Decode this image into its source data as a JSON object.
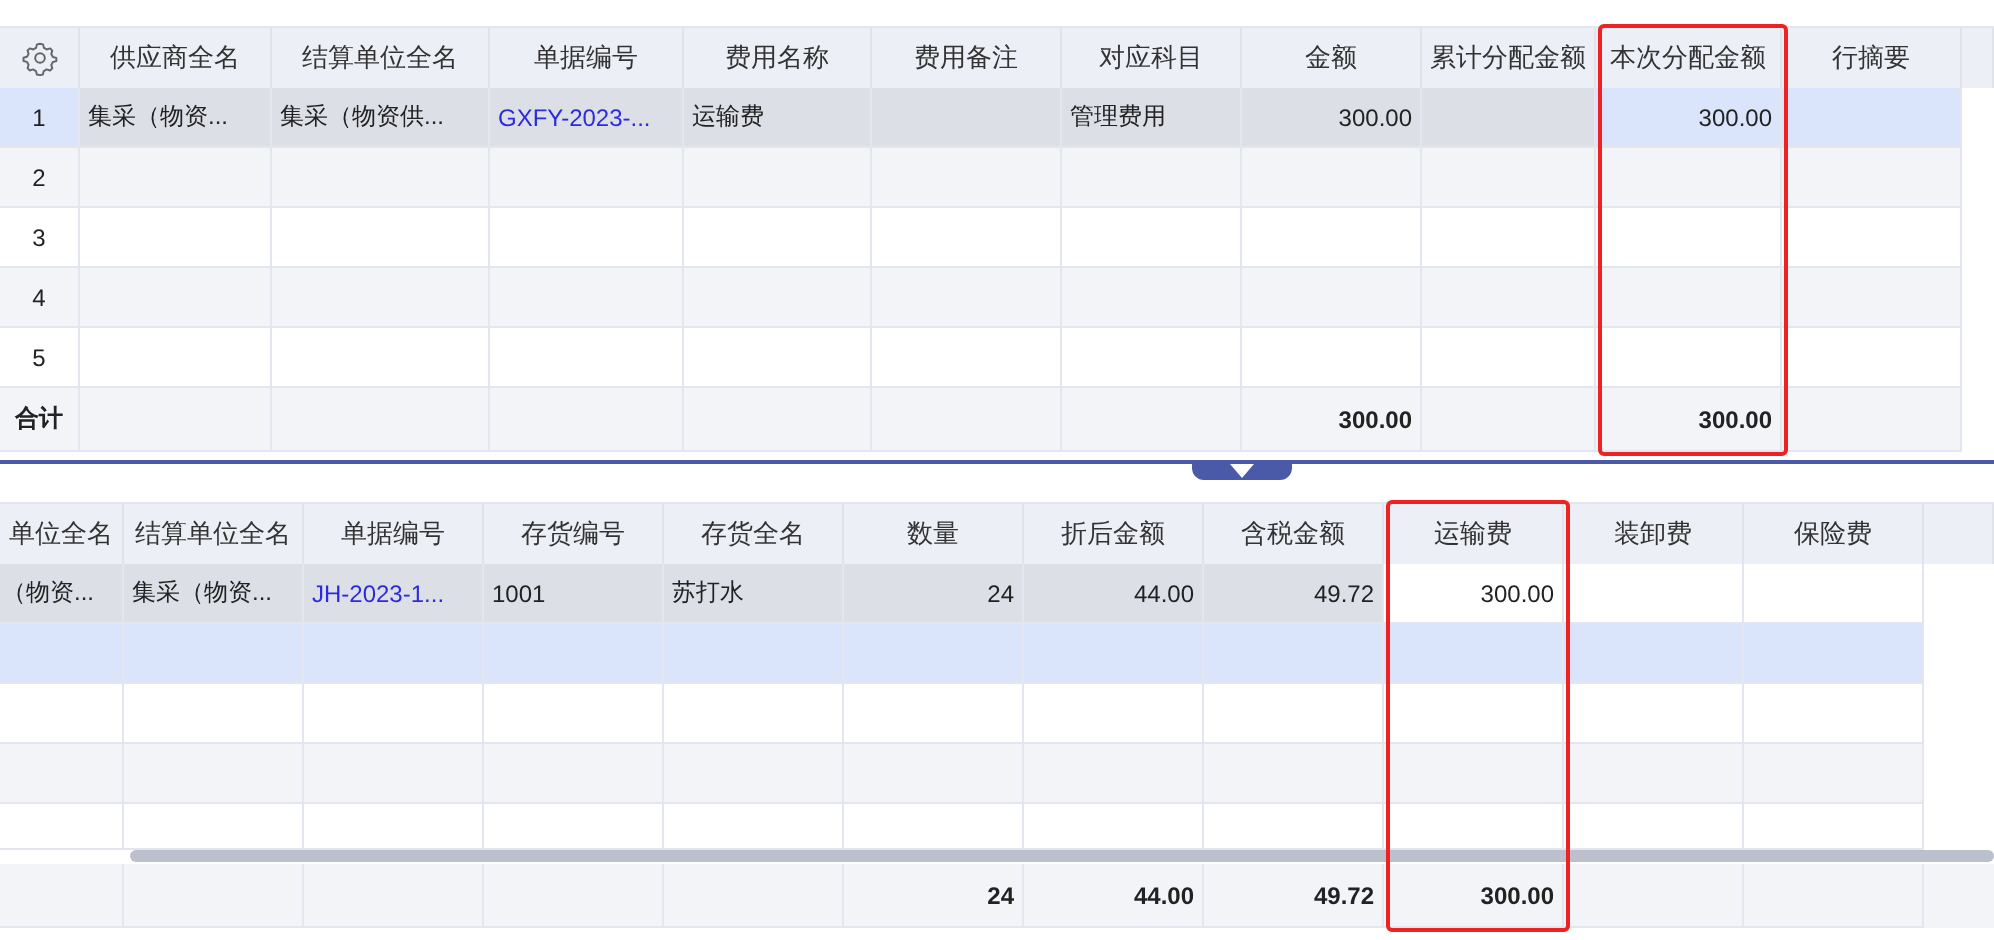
{
  "top_table": {
    "columns": [
      {
        "label": "供应商全名",
        "kind": "text",
        "editable": false,
        "highlighted": false
      },
      {
        "label": "结算单位全名",
        "kind": "text",
        "editable": false,
        "highlighted": false
      },
      {
        "label": "单据编号",
        "kind": "link",
        "editable": false,
        "highlighted": false
      },
      {
        "label": "费用名称",
        "kind": "text",
        "editable": false,
        "highlighted": false
      },
      {
        "label": "费用备注",
        "kind": "text",
        "editable": false,
        "highlighted": false
      },
      {
        "label": "对应科目",
        "kind": "text",
        "editable": false,
        "highlighted": false
      },
      {
        "label": "金额",
        "kind": "amount",
        "editable": false,
        "highlighted": false
      },
      {
        "label": "累计分配金额",
        "kind": "amount",
        "editable": false,
        "highlighted": false
      },
      {
        "label": "本次分配金额",
        "kind": "amount",
        "editable": true,
        "highlighted": true
      },
      {
        "label": "行摘要",
        "kind": "text",
        "editable": true,
        "highlighted": false
      }
    ],
    "rows": [
      {
        "number": "1",
        "selected": true,
        "cells": [
          "集采（物资...",
          "集采（物资供...",
          "GXFY-2023-...",
          "运输费",
          "",
          "管理费用",
          "300.00",
          "",
          "300.00",
          ""
        ]
      },
      {
        "number": "2",
        "selected": false,
        "cells": [
          "",
          "",
          "",
          "",
          "",
          "",
          "",
          "",
          "",
          ""
        ]
      },
      {
        "number": "3",
        "selected": false,
        "cells": [
          "",
          "",
          "",
          "",
          "",
          "",
          "",
          "",
          "",
          ""
        ]
      },
      {
        "number": "4",
        "selected": false,
        "cells": [
          "",
          "",
          "",
          "",
          "",
          "",
          "",
          "",
          "",
          ""
        ]
      },
      {
        "number": "5",
        "selected": false,
        "cells": [
          "",
          "",
          "",
          "",
          "",
          "",
          "",
          "",
          "",
          ""
        ]
      }
    ],
    "total": {
      "label": "合计",
      "cells": [
        "",
        "",
        "",
        "",
        "",
        "",
        "300.00",
        "",
        "300.00",
        ""
      ]
    }
  },
  "bottom_table": {
    "columns": [
      {
        "label": "单位全名",
        "kind": "text",
        "editable": false,
        "highlighted": false
      },
      {
        "label": "结算单位全名",
        "kind": "text",
        "editable": false,
        "highlighted": false
      },
      {
        "label": "单据编号",
        "kind": "link",
        "editable": false,
        "highlighted": false
      },
      {
        "label": "存货编号",
        "kind": "text",
        "editable": false,
        "highlighted": false
      },
      {
        "label": "存货全名",
        "kind": "text",
        "editable": false,
        "highlighted": false
      },
      {
        "label": "数量",
        "kind": "amount",
        "editable": false,
        "highlighted": false
      },
      {
        "label": "折后金额",
        "kind": "amount",
        "editable": false,
        "highlighted": false
      },
      {
        "label": "含税金额",
        "kind": "amount",
        "editable": false,
        "highlighted": false
      },
      {
        "label": "运输费",
        "kind": "amount",
        "editable": true,
        "highlighted": true
      },
      {
        "label": "装卸费",
        "kind": "amount",
        "editable": true,
        "highlighted": false
      },
      {
        "label": "保险费",
        "kind": "amount",
        "editable": true,
        "highlighted": false
      }
    ],
    "rows": [
      {
        "selected": false,
        "cells": [
          "（物资...",
          "集采（物资...",
          "JH-2023-1...",
          "1001",
          "苏打水",
          "24",
          "44.00",
          "49.72",
          "300.00",
          "",
          ""
        ]
      },
      {
        "selected": true,
        "cells": [
          "",
          "",
          "",
          "",
          "",
          "",
          "",
          "",
          "",
          "",
          ""
        ]
      },
      {
        "selected": false,
        "cells": [
          "",
          "",
          "",
          "",
          "",
          "",
          "",
          "",
          "",
          "",
          ""
        ]
      },
      {
        "selected": false,
        "cells": [
          "",
          "",
          "",
          "",
          "",
          "",
          "",
          "",
          "",
          "",
          ""
        ]
      },
      {
        "selected": false,
        "cells": [
          "",
          "",
          "",
          "",
          "",
          "",
          "",
          "",
          "",
          "",
          ""
        ]
      }
    ],
    "total": {
      "cells": [
        "",
        "",
        "",
        "",
        "",
        "24",
        "44.00",
        "49.72",
        "300.00",
        "",
        ""
      ]
    }
  }
}
